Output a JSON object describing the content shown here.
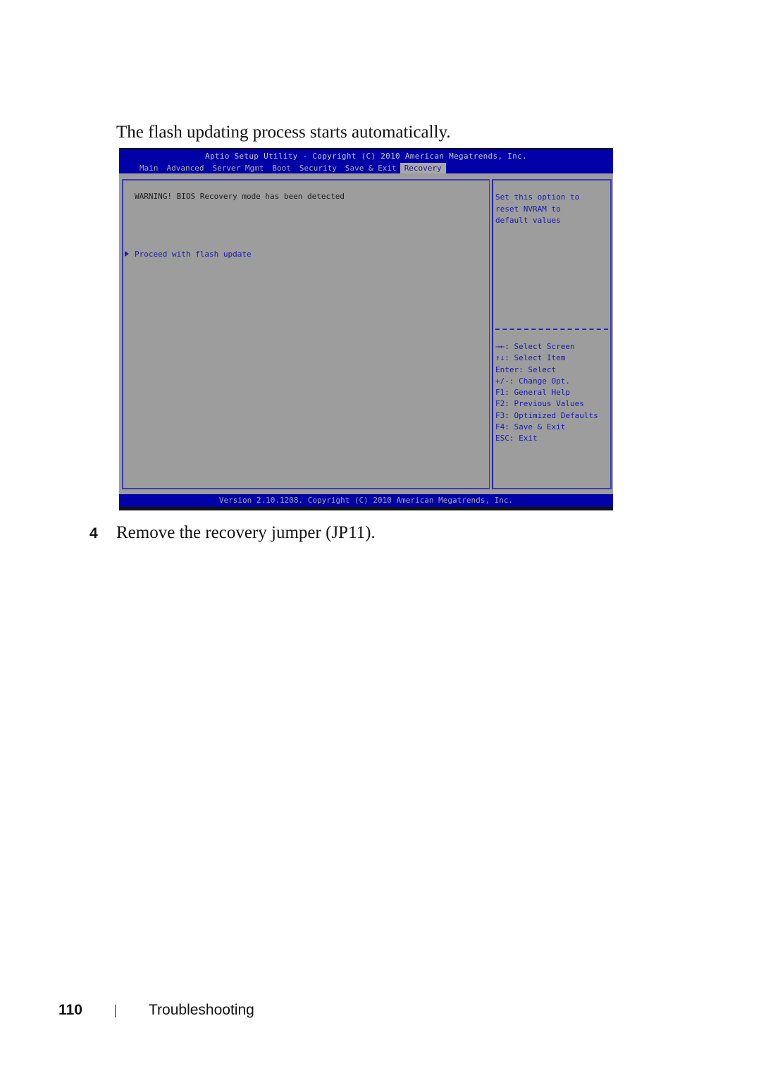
{
  "intro_text": "The flash updating process starts automatically.",
  "bios": {
    "title": "Aptio Setup Utility - Copyright (C) 2010 American Megatrends, Inc.",
    "tabs": [
      {
        "label": "Main",
        "active": false
      },
      {
        "label": "Advanced",
        "active": false
      },
      {
        "label": "Server Mgmt",
        "active": false
      },
      {
        "label": "Boot",
        "active": false
      },
      {
        "label": "Security",
        "active": false
      },
      {
        "label": "Save & Exit",
        "active": false
      },
      {
        "label": "Recovery",
        "active": true
      }
    ],
    "warning": "WARNING! BIOS Recovery mode has been detected",
    "menu_item": "Proceed with flash update",
    "help_lines": [
      "Set this option to",
      "reset NVRAM to",
      "default values"
    ],
    "keys": [
      "→←: Select Screen",
      "↑↓: Select Item",
      "Enter: Select",
      "+/-: Change Opt.",
      "F1: General Help",
      "F2: Previous Values",
      "F3: Optimized Defaults",
      "F4: Save & Exit",
      "ESC: Exit"
    ],
    "footer": "Version 2.10.1208. Copyright (C) 2010 American Megatrends, Inc.",
    "colors": {
      "header_blue": "#0000a8",
      "body_gray": "#9d9d9d",
      "highlight_text": "#1a1ab0"
    }
  },
  "step": {
    "number": "4",
    "text": "Remove the recovery jumper (JP11)."
  },
  "page_footer": {
    "page_number": "110",
    "section": "Troubleshooting"
  }
}
